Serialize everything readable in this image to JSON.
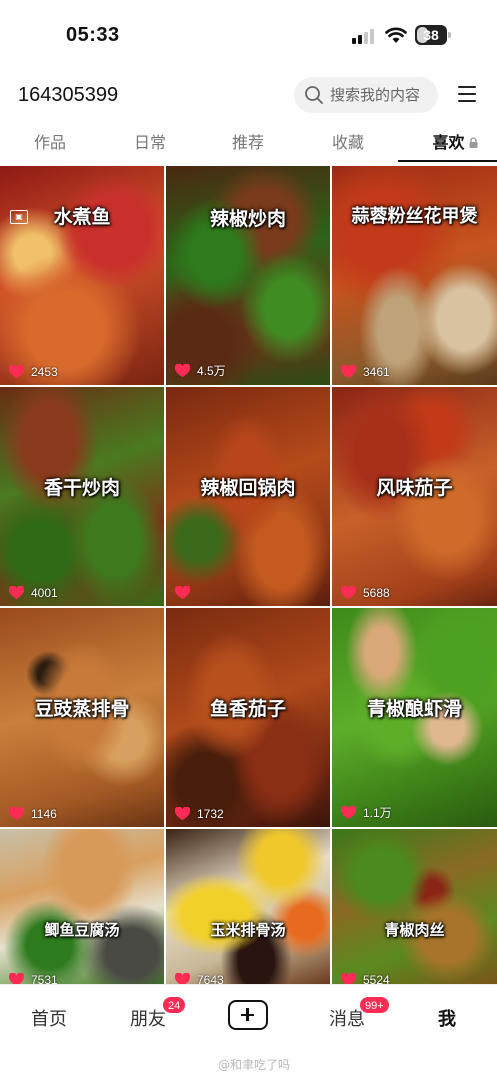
{
  "status_bar": {
    "time": "05:33",
    "battery": "38",
    "battery_level": 0.38
  },
  "header": {
    "user_id": "164305399",
    "search_placeholder": "搜索我的内容"
  },
  "tabs": [
    {
      "label": "作品",
      "active": false
    },
    {
      "label": "日常",
      "active": false
    },
    {
      "label": "推荐",
      "active": false
    },
    {
      "label": "收藏",
      "active": false
    },
    {
      "label": "喜欢",
      "active": true,
      "locked": true
    }
  ],
  "grid": [
    {
      "title": "水煮鱼",
      "likes": "2453"
    },
    {
      "title": "辣椒炒肉",
      "likes": "4.5万"
    },
    {
      "title": "蒜蓉粉丝花甲煲",
      "likes": "3461"
    },
    {
      "title": "香干炒肉",
      "likes": "4001"
    },
    {
      "title": "辣椒回锅肉",
      "likes": ""
    },
    {
      "title": "风味茄子",
      "likes": "5688"
    },
    {
      "title": "豆豉蒸排骨",
      "likes": "1146"
    },
    {
      "title": "鱼香茄子",
      "likes": "1732"
    },
    {
      "title": "青椒酿虾滑",
      "likes": "1.1万"
    },
    {
      "title": "鲫鱼豆腐汤",
      "likes": "7531"
    },
    {
      "title": "玉米排骨汤",
      "likes": "7643"
    },
    {
      "title": "青椒肉丝",
      "likes": "5524"
    }
  ],
  "bottom_nav": {
    "home": "首页",
    "friends": "朋友",
    "friends_badge": "24",
    "messages": "消息",
    "messages_badge": "99+",
    "me": "我"
  },
  "watermark": "@和聿吃了吗",
  "colors": {
    "accent": "#fe2c55",
    "text": "#111111",
    "muted": "#777777"
  }
}
